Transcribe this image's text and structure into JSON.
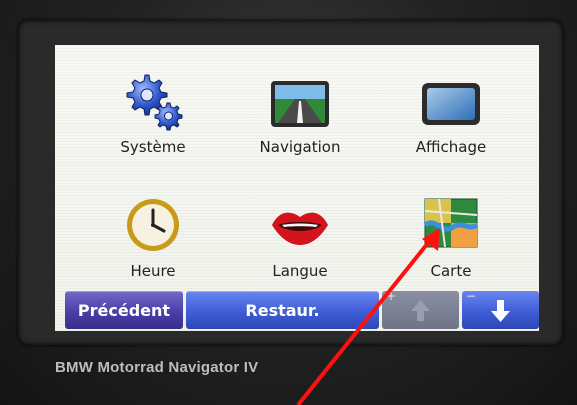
{
  "menu": {
    "items": [
      {
        "label": "Système",
        "icon": "gears-icon"
      },
      {
        "label": "Navigation",
        "icon": "road-icon"
      },
      {
        "label": "Affichage",
        "icon": "display-icon"
      },
      {
        "label": "Heure",
        "icon": "clock-icon"
      },
      {
        "label": "Langue",
        "icon": "lips-icon"
      },
      {
        "label": "Carte",
        "icon": "map-icon"
      }
    ]
  },
  "bottom_bar": {
    "back_label": "Précédent",
    "restore_label": "Restaur.",
    "up_icon": "arrow-up-icon",
    "down_icon": "arrow-down-icon",
    "plus_sign": "+",
    "minus_sign": "−"
  },
  "device": {
    "brand_label": "BMW Motorrad Navigator IV"
  },
  "colors": {
    "back_button": "#4b3fa8",
    "restore_button": "#3f5ed6",
    "down_button": "#3f5ed6",
    "up_button_disabled": "#6f7386",
    "annotation_arrow": "#ff0000"
  }
}
